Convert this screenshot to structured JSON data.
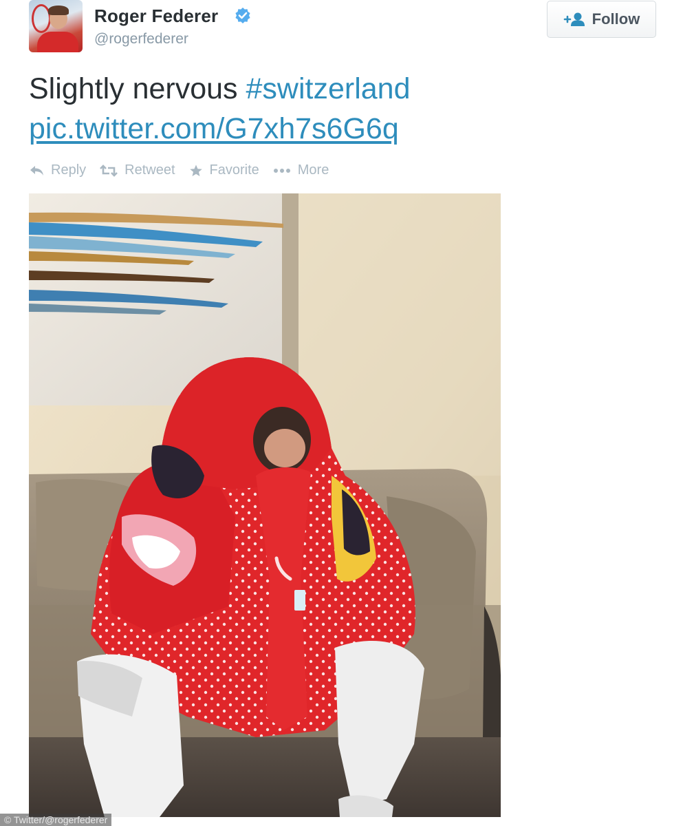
{
  "tweet": {
    "author_name": "Roger Federer",
    "author_handle": "@rogerfederer",
    "verified_icon": "verified-badge-icon",
    "follow_label": "Follow",
    "text_plain": "Slightly nervous ",
    "hashtag": "#switzerland",
    "pic_link": "pic.twitter.com/G7xh7s6G6q",
    "actions": {
      "reply": "Reply",
      "retweet": "Retweet",
      "favorite": "Favorite",
      "more": "More"
    }
  },
  "photo_credit": "© Twitter/@rogerfederer",
  "colors": {
    "link": "#2e8dbc",
    "verified": "#55acee",
    "muted": "#8899a6",
    "towel_red": "#e0262a"
  }
}
